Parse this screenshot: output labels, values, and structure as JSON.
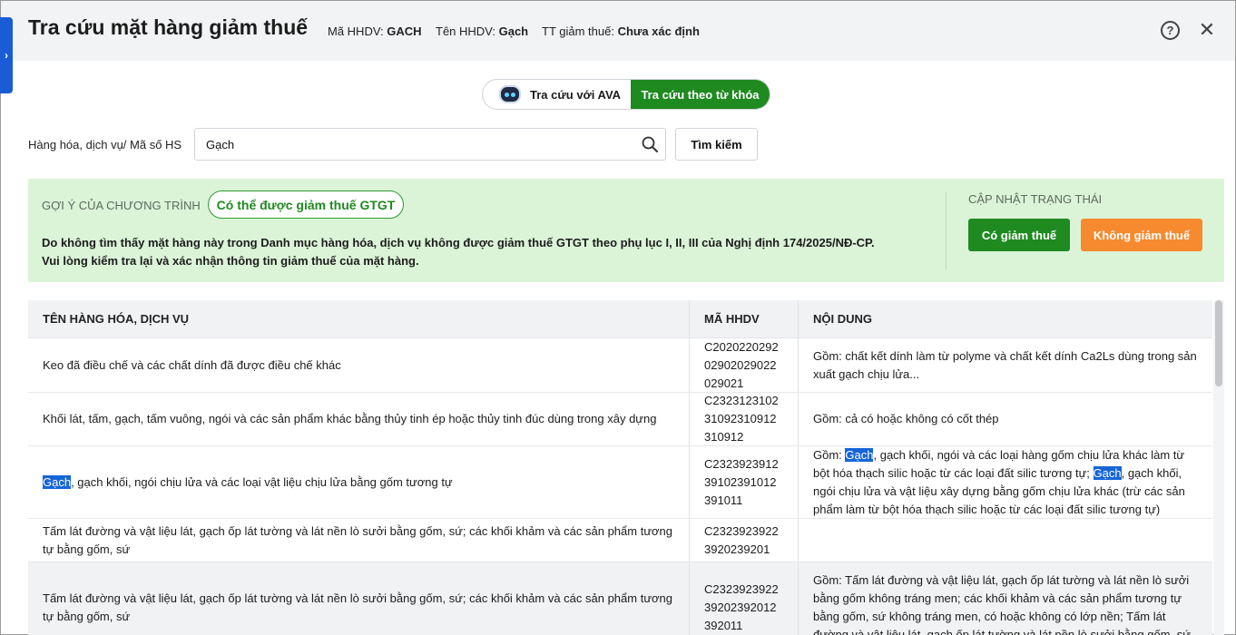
{
  "header": {
    "title": "Tra cứu mặt hàng giảm thuế",
    "meta": [
      {
        "label": "Mã HHDV:",
        "value": "GACH"
      },
      {
        "label": "Tên HHDV:",
        "value": "Gạch"
      },
      {
        "label": "TT giảm thuế:",
        "value": "Chưa xác định"
      }
    ],
    "help_glyph": "?",
    "close_glyph": "✕"
  },
  "side_tab": {
    "glyph": "›"
  },
  "toggle": {
    "ava_label": "Tra cứu với AVA",
    "keyword_label": "Tra cứu theo từ khóa",
    "active": "keyword"
  },
  "search": {
    "label": "Hàng hóa, dịch vụ/ Mã số HS",
    "value": "Gạch",
    "button": "Tìm kiếm"
  },
  "suggestion": {
    "label": "GỢI Ý CỦA CHƯƠNG TRÌNH",
    "pill": "Có thể được giảm thuế GTGT",
    "message_line1": "Do không tìm thấy mặt hàng này trong Danh mục hàng hóa, dịch vụ không được giảm thuế GTGT theo phụ lục I, II, III của Nghị định 174/2025/NĐ-CP.",
    "message_line2": "Vui lòng kiểm tra lại và xác nhận thông tin giảm thuế của mặt hàng.",
    "status_label": "CẬP NHẬT TRẠNG THÁI",
    "btn_yes": "Có giảm thuế",
    "btn_no": "Không giảm thuế"
  },
  "table": {
    "columns": [
      "TÊN HÀNG HÓA, DỊCH VỤ",
      "MÃ HHDV",
      "NỘI DUNG"
    ],
    "rows": [
      {
        "name": "Keo đã điều chế và các chất dính đã được điều chế khác",
        "code": "C2020220292\n02902029022\n029021",
        "content": "Gồm: chất kết dính làm từ polyme và chất kết dính Ca2Ls dùng trong sản xuất gạch chịu lửa..."
      },
      {
        "name": "Khối lát, tấm, gạch, tấm vuông, ngói và các sản phẩm khác bằng thủy tinh ép hoặc thủy tinh đúc dùng trong xây dựng",
        "code": "C2323123102\n31092310912\n310912",
        "content": "Gồm: cả có hoặc không có cốt thép"
      },
      {
        "name_highlight": "Gạch",
        "name_rest": ", gạch khối, ngói chịu lửa và các loại vật liệu chịu lửa bằng gốm tương tự",
        "code": "C2323923912\n39102391012\n391011",
        "content_p1": "Gồm: ",
        "content_hl1": "Gạch",
        "content_p2": ", gạch khối, ngói và các loại hàng gốm chịu lửa khác làm từ bột hóa thạch silic hoặc từ các loại đất silic tương tự; ",
        "content_hl2": "Gạch",
        "content_p3": ", gạch khối, ngói chịu lửa và vật liệu xây dựng bằng gốm chịu lửa khác (trừ các sản phẩm làm từ bột hóa thạch silic hoặc từ các loại đất silic tương tự)"
      },
      {
        "name": "Tấm lát đường và vật liệu lát, gạch ốp lát tường và lát nền lò sưởi bằng gốm, sứ; các khối khảm và các sản phẩm tương tự bằng gốm, sứ",
        "code": "C2323923922\n3920239201",
        "content": ""
      },
      {
        "name": "Tấm lát đường và vật liệu lát, gạch ốp lát tường và lát nền lò sưởi bằng gốm, sứ; các khối khảm và các sản phẩm tương tự bằng gốm, sứ",
        "code": "C2323923922\n39202392012\n392011",
        "content": "Gồm: Tấm lát đường và vật liệu lát, gạch ốp lát tường và lát nền lò sưởi bằng gốm không tráng men; các khối khảm và các sản phẩm tương tự bằng gốm, sứ không tráng men, có hoặc không có lớp nền; Tấm lát đường và vật liệu lát, gạch ốp lát tường và lát nền lò sưởi bằng gốm, sứ"
      }
    ]
  },
  "colors": {
    "primary_green": "#1e8a1f",
    "orange": "#f78a2f",
    "suggest_bg": "#dbf4d8",
    "highlight_blue": "#1565d8",
    "side_tab_blue": "#1a5bd6"
  }
}
